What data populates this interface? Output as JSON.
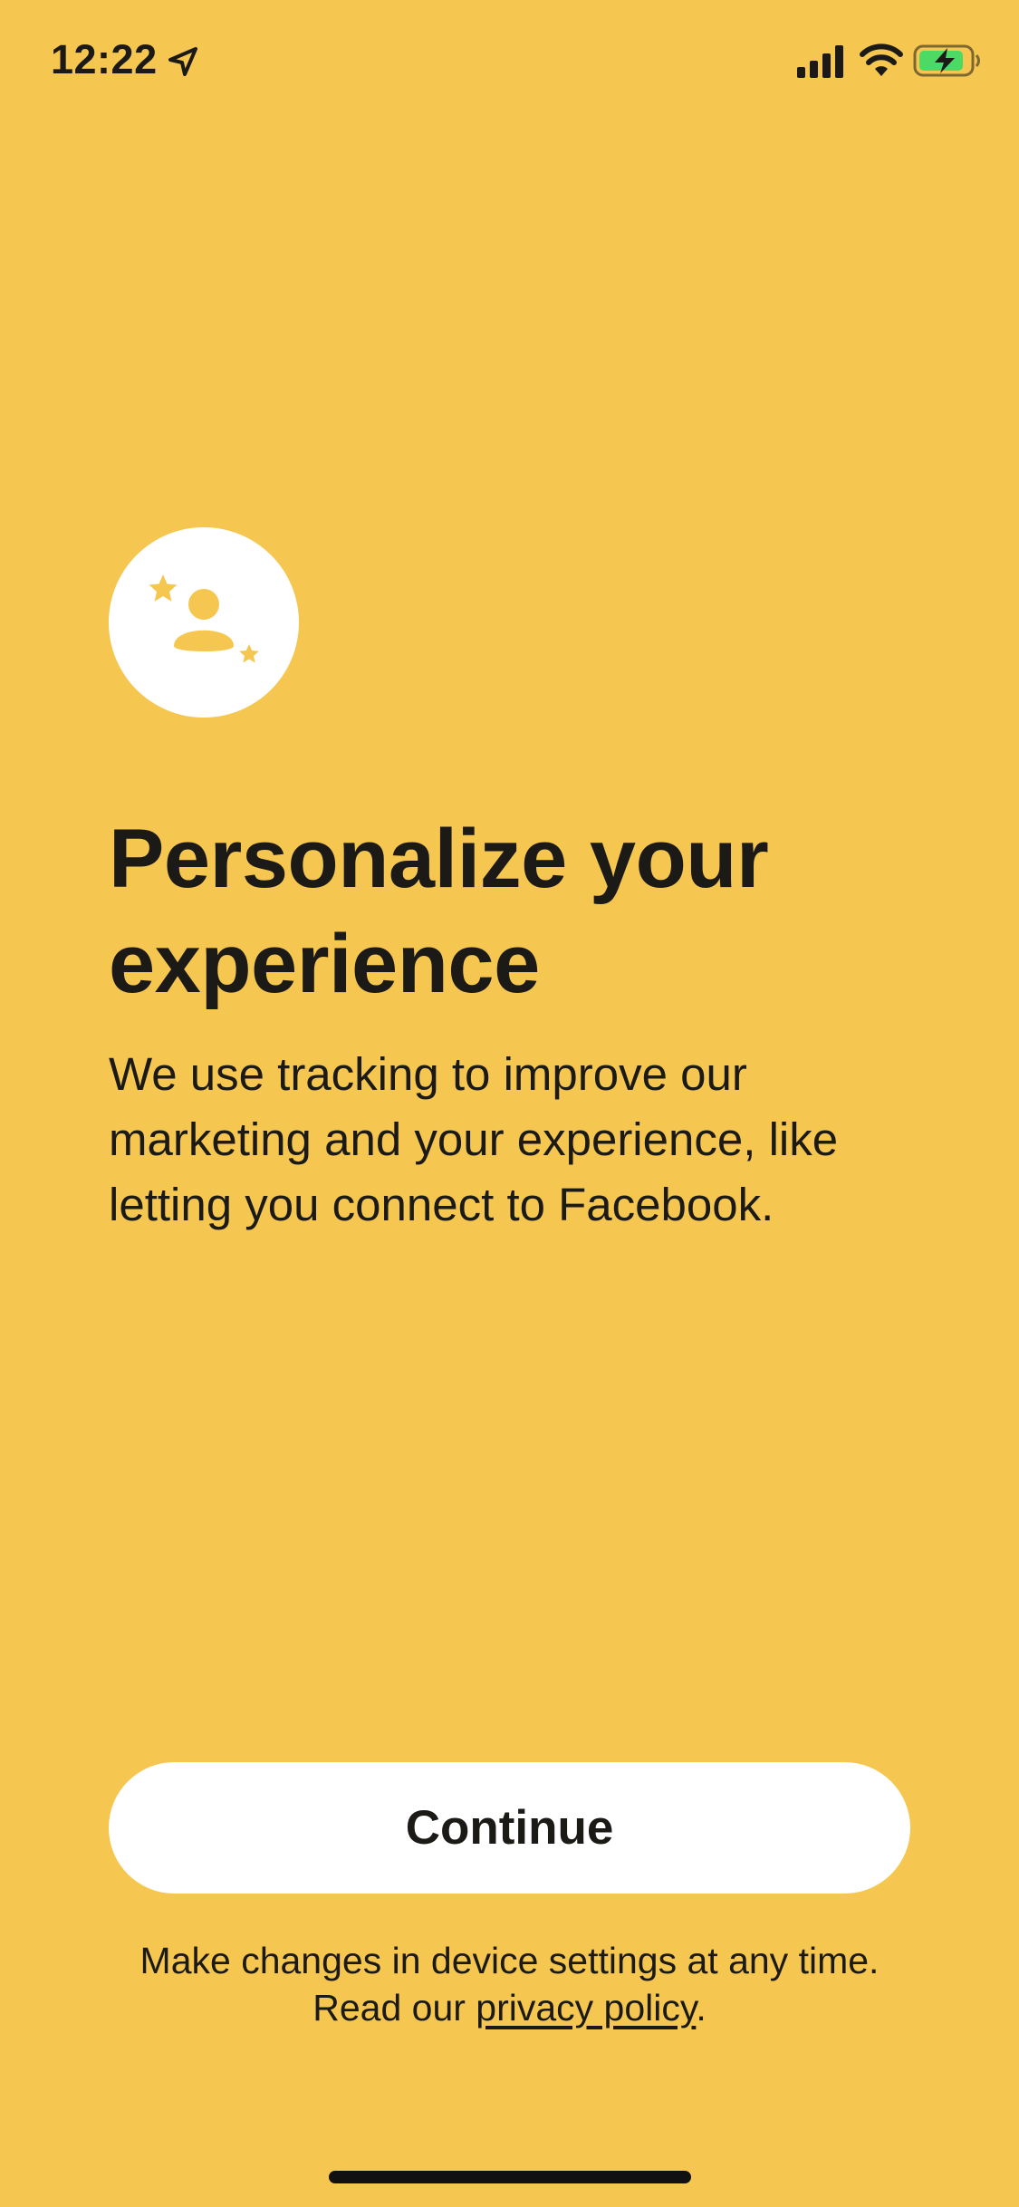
{
  "status_bar": {
    "time": "12:22",
    "icons": [
      "location-arrow-icon",
      "cellular-signal-icon",
      "wifi-icon",
      "battery-charging-icon"
    ]
  },
  "hero": {
    "icon": "personalize-profile-stars-icon"
  },
  "content": {
    "title": "Personalize your experience",
    "body": "We use tracking to improve our marketing and your experience, like letting you connect to Facebook."
  },
  "actions": {
    "continue_label": "Continue"
  },
  "footer": {
    "line1": "Make changes in device settings at any time.",
    "line2_prefix": "Read our ",
    "privacy_link_label": "privacy policy",
    "line2_suffix": "."
  },
  "colors": {
    "background": "#F6C750",
    "button": "#FFFFFF",
    "text": "#1B1A17",
    "battery_fill": "#4CD964"
  }
}
